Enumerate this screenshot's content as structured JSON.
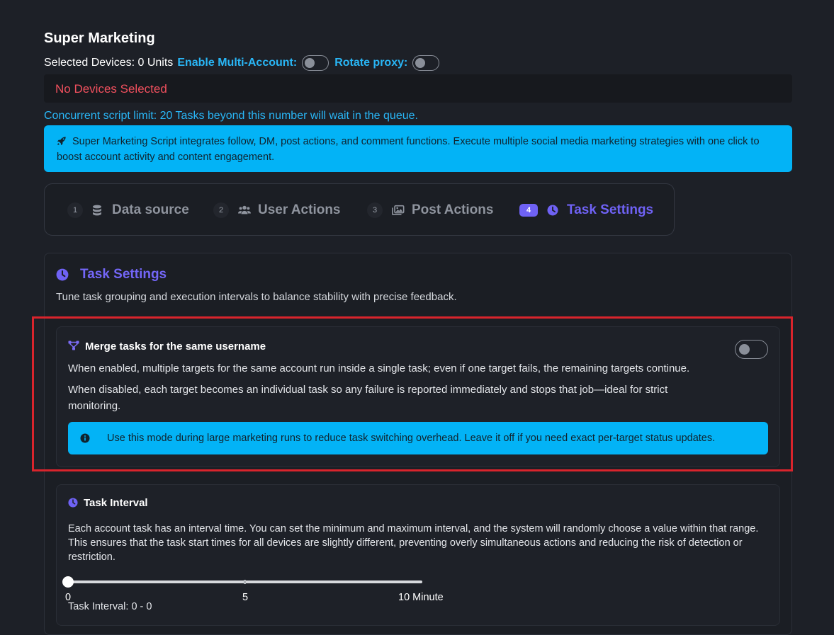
{
  "header": {
    "title": "Super Marketing",
    "selected_devices": "Selected Devices: 0 Units",
    "multi_account_label": "Enable Multi-Account:",
    "multi_account_enabled": false,
    "rotate_proxy_label": "Rotate proxy:",
    "rotate_proxy_enabled": false,
    "no_devices": "No Devices Selected",
    "concurrent_limit": "Concurrent script limit: 20 Tasks beyond this number will wait in the queue."
  },
  "banner": {
    "icon": "rocket-icon",
    "text": "Super Marketing Script integrates follow, DM, post actions, and comment functions. Execute multiple social media marketing strategies with one click to boost account activity and content engagement."
  },
  "steps": [
    {
      "num": "1",
      "label": "Data source",
      "icon": "database-icon",
      "active": false
    },
    {
      "num": "2",
      "label": "User Actions",
      "icon": "users-icon",
      "active": false
    },
    {
      "num": "3",
      "label": "Post Actions",
      "icon": "images-icon",
      "active": false
    },
    {
      "num": "4",
      "label": "Task Settings",
      "icon": "clock-icon",
      "active": true
    }
  ],
  "task_settings": {
    "title": "Task Settings",
    "description": "Tune task grouping and execution intervals to balance stability with precise feedback.",
    "merge": {
      "title": "Merge tasks for the same username",
      "enabled": false,
      "enabled_text": "When enabled, multiple targets for the same account run inside a single task; even if one target fails, the remaining targets continue.",
      "disabled_text": "When disabled, each target becomes an individual task so any failure is reported immediately and stops that job—ideal for strict monitoring.",
      "tip": "Use this mode during large marketing runs to reduce task switching overhead. Leave it off if you need exact per-target status updates."
    },
    "interval": {
      "title": "Task Interval",
      "description": "Each account task has an interval time. You can set the minimum and maximum interval, and the system will randomly choose a value within that range. This ensures that the task start times for all devices are slightly different, preventing overly simultaneous actions and reducing the risk of detection or restriction.",
      "min_label": "0",
      "mid_label": "5",
      "max_label": "10 Minute",
      "range_min": 0,
      "range_max": 10,
      "value_min": 0,
      "value_max": 0,
      "readout": "Task Interval: 0 - 0"
    }
  },
  "colors": {
    "background": "#1d2027",
    "accent_blue": "#29b6f6",
    "banner_blue": "#03b3f6",
    "accent_purple": "#6f62f5",
    "error_red": "#f0505e",
    "highlight_red": "#d9242c"
  }
}
